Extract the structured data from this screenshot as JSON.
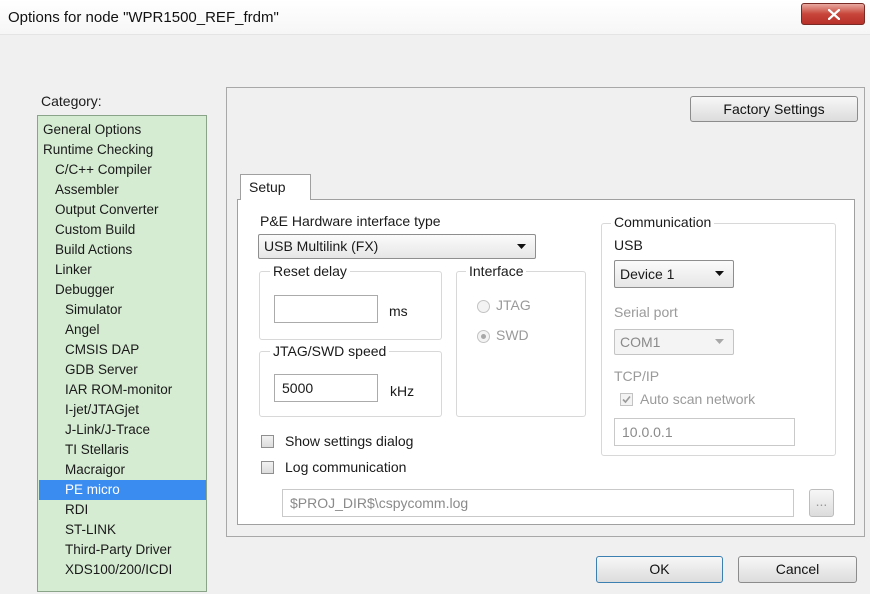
{
  "window": {
    "title": "Options for node \"WPR1500_REF_frdm\"",
    "close_glyph": "✕"
  },
  "category": {
    "label": "Category:",
    "selected_index": 18,
    "items": [
      {
        "label": "General Options",
        "indent": 0
      },
      {
        "label": "Runtime Checking",
        "indent": 0
      },
      {
        "label": "C/C++ Compiler",
        "indent": 1
      },
      {
        "label": "Assembler",
        "indent": 1
      },
      {
        "label": "Output Converter",
        "indent": 1
      },
      {
        "label": "Custom Build",
        "indent": 1
      },
      {
        "label": "Build Actions",
        "indent": 1
      },
      {
        "label": "Linker",
        "indent": 1
      },
      {
        "label": "Debugger",
        "indent": 1
      },
      {
        "label": "Simulator",
        "indent": 2
      },
      {
        "label": "Angel",
        "indent": 2
      },
      {
        "label": "CMSIS DAP",
        "indent": 2
      },
      {
        "label": "GDB Server",
        "indent": 2
      },
      {
        "label": "IAR ROM-monitor",
        "indent": 2
      },
      {
        "label": "I-jet/JTAGjet",
        "indent": 2
      },
      {
        "label": "J-Link/J-Trace",
        "indent": 2
      },
      {
        "label": "TI Stellaris",
        "indent": 2
      },
      {
        "label": "Macraigor",
        "indent": 2
      },
      {
        "label": "PE micro",
        "indent": 2
      },
      {
        "label": "RDI",
        "indent": 2
      },
      {
        "label": "ST-LINK",
        "indent": 2
      },
      {
        "label": "Third-Party Driver",
        "indent": 2
      },
      {
        "label": "XDS100/200/ICDI",
        "indent": 2
      }
    ]
  },
  "panel": {
    "factory_settings_label": "Factory Settings",
    "tab_label": "Setup",
    "hw_interface_label": "P&E Hardware interface type",
    "hw_interface_value": "USB Multilink (FX)",
    "reset_delay": {
      "title": "Reset delay",
      "value": "",
      "unit": "ms"
    },
    "jtag_speed": {
      "title": "JTAG/SWD speed",
      "value": "5000",
      "unit": "kHz"
    },
    "interface": {
      "title": "Interface",
      "options": [
        "JTAG",
        "SWD"
      ],
      "selected": "SWD"
    },
    "communication": {
      "title": "Communication",
      "usb_label": "USB",
      "usb_device": "Device 1",
      "serial_label": "Serial port",
      "serial_value": "COM1",
      "tcpip_label": "TCP/IP",
      "auto_scan_label": "Auto scan network",
      "auto_scan_checked": true,
      "ip_value": "10.0.0.1"
    },
    "show_settings_label": "Show settings dialog",
    "log_comm_label": "Log communication",
    "log_path": "$PROJ_DIR$\\cspycomm.log",
    "browse_label": "..."
  },
  "buttons": {
    "ok": "OK",
    "cancel": "Cancel"
  },
  "colors": {
    "category_bg": "#d5ecd2",
    "selection": "#3b8cf0",
    "close_red": "#c7453a"
  }
}
